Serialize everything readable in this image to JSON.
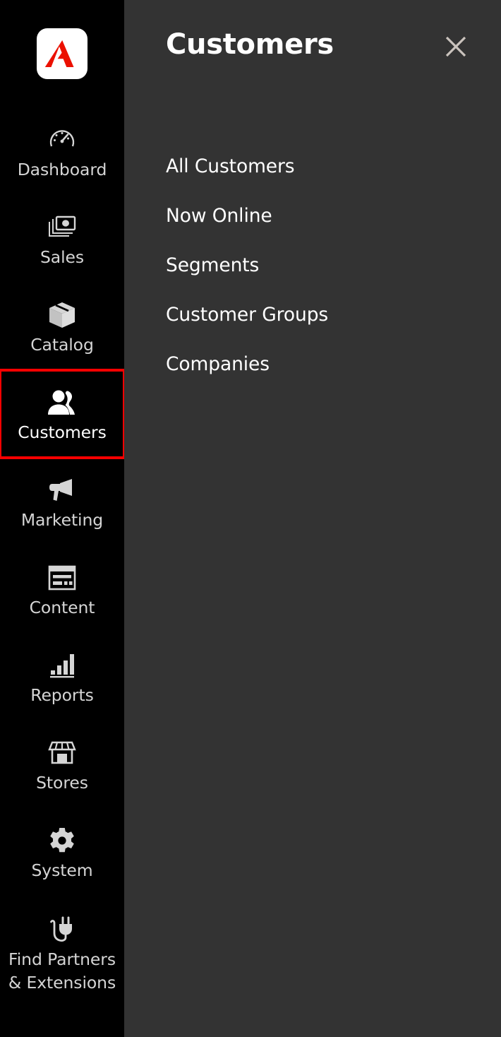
{
  "colors": {
    "sidebar_bg": "#000000",
    "panel_bg": "#333333",
    "accent_red": "#eb1000",
    "selection_outline": "#f70000",
    "sidebar_label": "#d5d5d5",
    "panel_text": "#ffffff",
    "close_icon": "#cac3bd"
  },
  "sidebar": {
    "logo": {
      "name": "adobe-commerce-logo",
      "alt": "Adobe"
    },
    "items": [
      {
        "label": "Dashboard",
        "icon": "gauge-icon",
        "selected": false
      },
      {
        "label": "Sales",
        "icon": "money-stack-icon",
        "selected": false
      },
      {
        "label": "Catalog",
        "icon": "box-icon",
        "selected": false
      },
      {
        "label": "Customers",
        "icon": "users-icon",
        "selected": true
      },
      {
        "label": "Marketing",
        "icon": "megaphone-icon",
        "selected": false
      },
      {
        "label": "Content",
        "icon": "page-layout-icon",
        "selected": false
      },
      {
        "label": "Reports",
        "icon": "bar-chart-icon",
        "selected": false
      },
      {
        "label": "Stores",
        "icon": "storefront-icon",
        "selected": false
      },
      {
        "label": "System",
        "icon": "gear-icon",
        "selected": false
      },
      {
        "label": "Find Partners\n& Extensions",
        "icon": "plug-icon",
        "selected": false
      }
    ]
  },
  "panel": {
    "title": "Customers",
    "close_icon": "close-icon",
    "menu": [
      {
        "label": "All Customers"
      },
      {
        "label": "Now Online"
      },
      {
        "label": "Segments"
      },
      {
        "label": "Customer Groups"
      },
      {
        "label": "Companies"
      }
    ]
  }
}
